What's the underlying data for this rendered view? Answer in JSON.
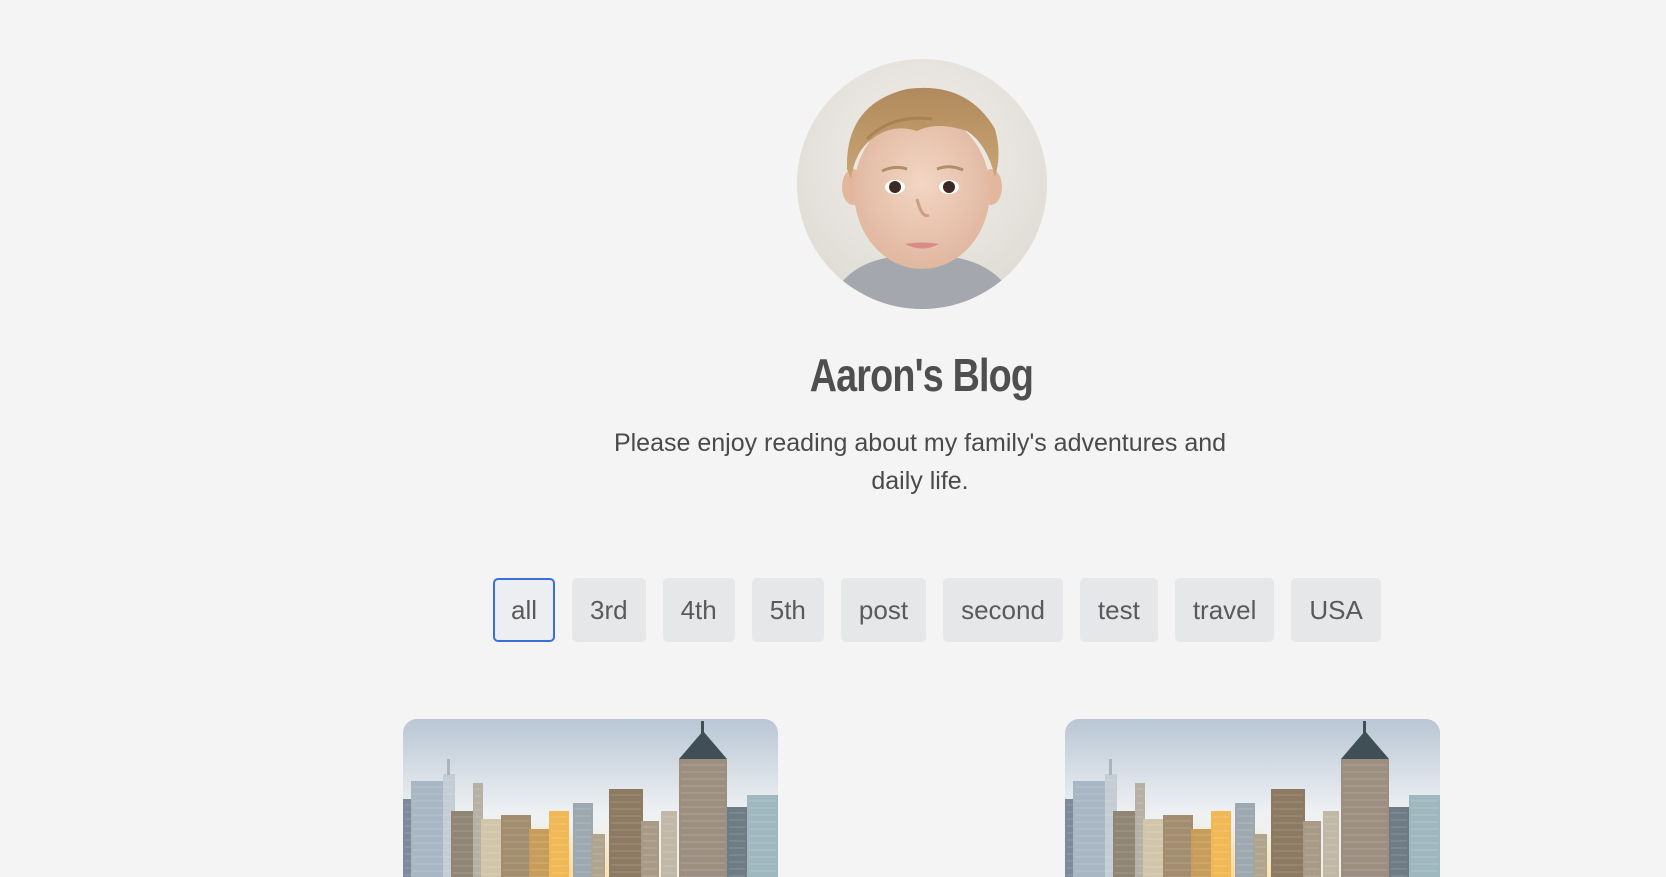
{
  "profile": {
    "avatar_alt": "Aaron's Blog",
    "title": "Aaron's Blog",
    "tagline": "Please enjoy reading about my family's adventures and daily life."
  },
  "tags": [
    {
      "label": "all",
      "active": true
    },
    {
      "label": "3rd",
      "active": false
    },
    {
      "label": "4th",
      "active": false
    },
    {
      "label": "5th",
      "active": false
    },
    {
      "label": "post",
      "active": false
    },
    {
      "label": "second",
      "active": false
    },
    {
      "label": "test",
      "active": false
    },
    {
      "label": "travel",
      "active": false
    },
    {
      "label": "USA",
      "active": false
    }
  ],
  "colors": {
    "background": "#f4f4f4",
    "tag_bg": "#e6e7e9",
    "tag_active_border": "#3b6fd8",
    "text": "#4a4a4a"
  },
  "cards": [
    {
      "image": "city-skyline-image"
    },
    {
      "image": "city-skyline-image"
    }
  ]
}
